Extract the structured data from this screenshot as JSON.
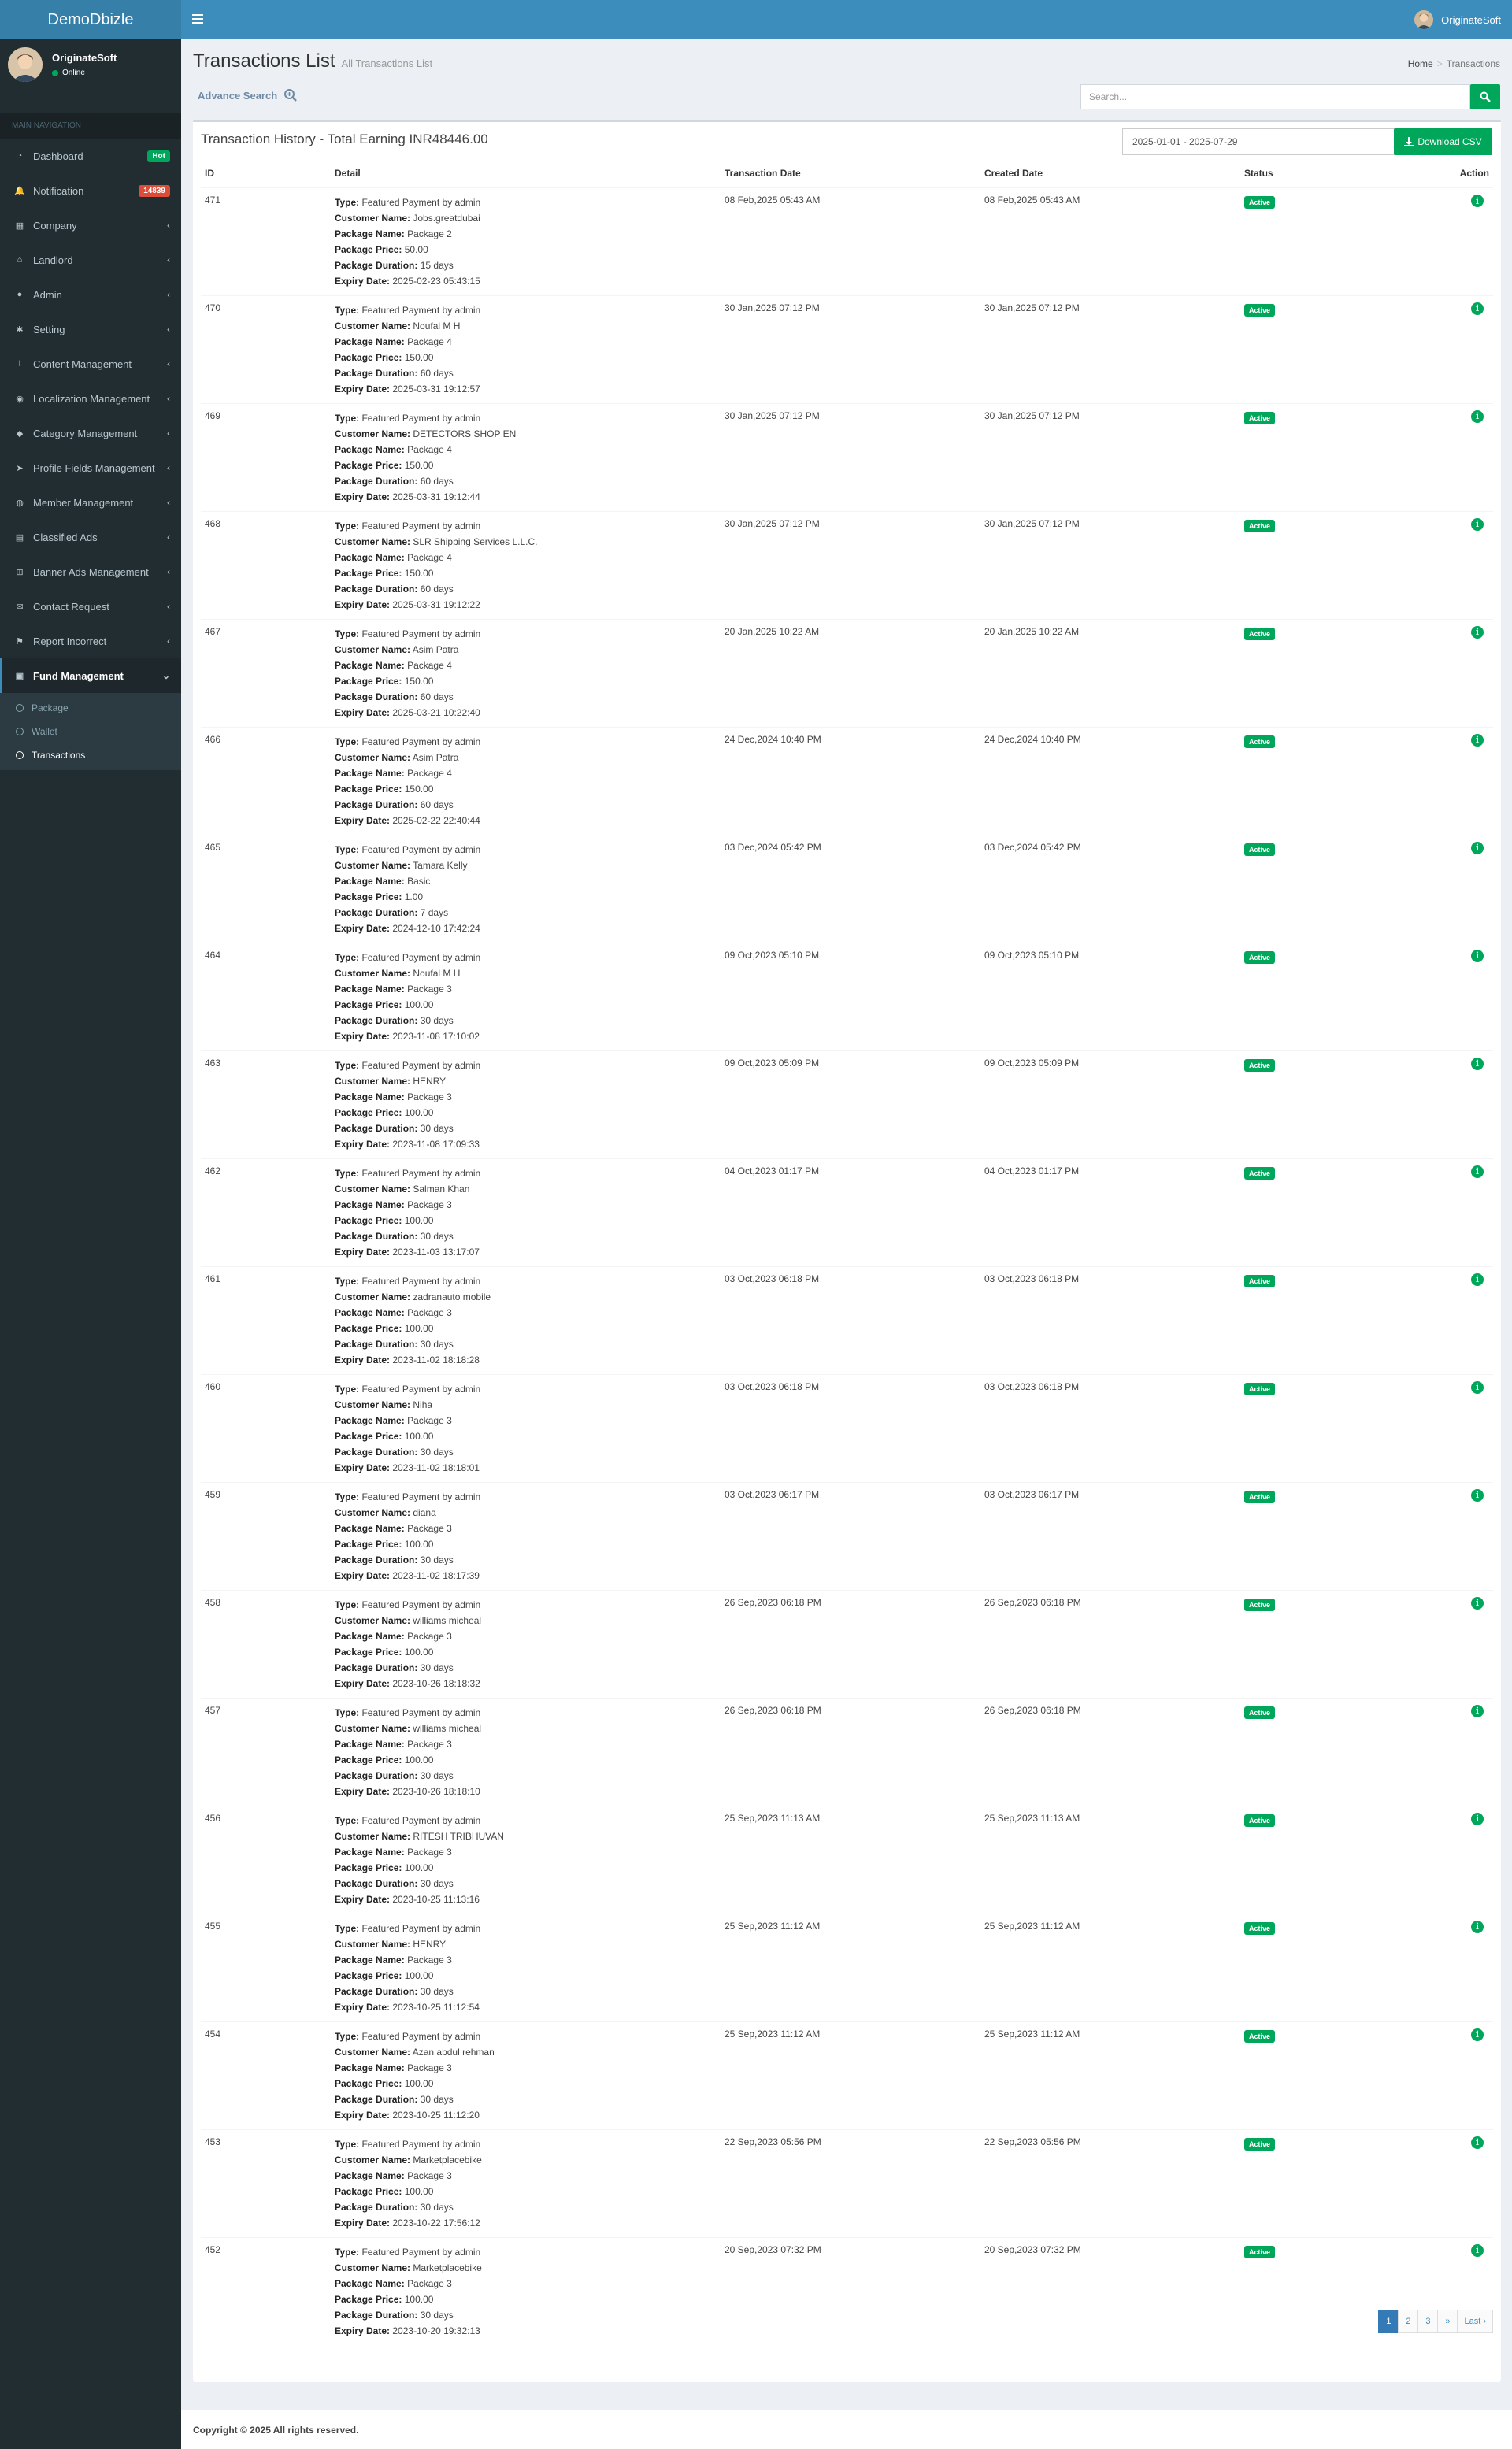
{
  "app": {
    "logo": "DemoDbizle",
    "top_user": "OriginateSoft"
  },
  "sidebar": {
    "user": {
      "name": "OriginateSoft",
      "status": "Online"
    },
    "header": "MAIN NAVIGATION",
    "items": [
      {
        "label": "Dashboard",
        "icon": "dashboard-icon",
        "badge": "Hot",
        "badge_color": "#00a65a"
      },
      {
        "label": "Notification",
        "icon": "bell-icon",
        "badge": "14839",
        "badge_color": "#dd4b39"
      },
      {
        "label": "Company",
        "icon": "building-icon"
      },
      {
        "label": "Landlord",
        "icon": "bank-icon"
      },
      {
        "label": "Admin",
        "icon": "user-icon"
      },
      {
        "label": "Setting",
        "icon": "gear-icon"
      },
      {
        "label": "Content Management",
        "icon": "text-cursor-icon"
      },
      {
        "label": "Localization Management",
        "icon": "map-marker-icon"
      },
      {
        "label": "Category Management",
        "icon": "tag-icon"
      },
      {
        "label": "Profile Fields Management",
        "icon": "pointer-icon"
      },
      {
        "label": "Member Management",
        "icon": "users-icon"
      },
      {
        "label": "Classified Ads",
        "icon": "newspaper-icon"
      },
      {
        "label": "Banner Ads Management",
        "icon": "cart-icon"
      },
      {
        "label": "Contact Request",
        "icon": "envelope-icon"
      },
      {
        "label": "Report Incorrect",
        "icon": "flag-icon"
      },
      {
        "label": "Fund Management",
        "icon": "money-icon",
        "active": true
      }
    ],
    "subitems": [
      {
        "label": "Package"
      },
      {
        "label": "Wallet"
      },
      {
        "label": "Transactions",
        "active": true
      }
    ]
  },
  "page": {
    "title": "Transactions List",
    "subtitle": "All Transactions List",
    "breadcrumb": [
      "Home",
      "Transactions"
    ],
    "advance_search": "Advance Search",
    "search_placeholder": "Search..."
  },
  "box": {
    "title": "Transaction History - Total Earning INR48446.00",
    "date_range": "2025-01-01 - 2025-07-29",
    "csv_label": "Download CSV"
  },
  "table": {
    "columns": [
      "ID",
      "Detail",
      "Transaction Date",
      "Created Date",
      "Status",
      "Action"
    ],
    "labels": {
      "type": "Type:",
      "customer": "Customer Name:",
      "package": "Package Name:",
      "price": "Package Price:",
      "duration": "Package Duration:",
      "expiry": "Expiry Date:"
    },
    "rows": [
      {
        "id": "471",
        "type": "Featured Payment by admin",
        "customer": "Jobs.greatdubai",
        "package": "Package 2",
        "price": "50.00",
        "duration": "15 days",
        "expiry": "2025-02-23 05:43:15",
        "tdate": "08 Feb,2025 05:43 AM",
        "cdate": "08 Feb,2025 05:43 AM",
        "status": "Active"
      },
      {
        "id": "470",
        "type": "Featured Payment by admin",
        "customer": "Noufal M H",
        "package": "Package 4",
        "price": "150.00",
        "duration": "60 days",
        "expiry": "2025-03-31 19:12:57",
        "tdate": "30 Jan,2025 07:12 PM",
        "cdate": "30 Jan,2025 07:12 PM",
        "status": "Active"
      },
      {
        "id": "469",
        "type": "Featured Payment by admin",
        "customer": "DETECTORS SHOP EN",
        "package": "Package 4",
        "price": "150.00",
        "duration": "60 days",
        "expiry": "2025-03-31 19:12:44",
        "tdate": "30 Jan,2025 07:12 PM",
        "cdate": "30 Jan,2025 07:12 PM",
        "status": "Active"
      },
      {
        "id": "468",
        "type": "Featured Payment by admin",
        "customer": "SLR Shipping Services L.L.C.",
        "package": "Package 4",
        "price": "150.00",
        "duration": "60 days",
        "expiry": "2025-03-31 19:12:22",
        "tdate": "30 Jan,2025 07:12 PM",
        "cdate": "30 Jan,2025 07:12 PM",
        "status": "Active"
      },
      {
        "id": "467",
        "type": "Featured Payment by admin",
        "customer": "Asim Patra",
        "package": "Package 4",
        "price": "150.00",
        "duration": "60 days",
        "expiry": "2025-03-21 10:22:40",
        "tdate": "20 Jan,2025 10:22 AM",
        "cdate": "20 Jan,2025 10:22 AM",
        "status": "Active"
      },
      {
        "id": "466",
        "type": "Featured Payment by admin",
        "customer": "Asim Patra",
        "package": "Package 4",
        "price": "150.00",
        "duration": "60 days",
        "expiry": "2025-02-22 22:40:44",
        "tdate": "24 Dec,2024 10:40 PM",
        "cdate": "24 Dec,2024 10:40 PM",
        "status": "Active"
      },
      {
        "id": "465",
        "type": "Featured Payment by admin",
        "customer": "Tamara Kelly",
        "package": "Basic",
        "price": "1.00",
        "duration": "7 days",
        "expiry": "2024-12-10 17:42:24",
        "tdate": "03 Dec,2024 05:42 PM",
        "cdate": "03 Dec,2024 05:42 PM",
        "status": "Active"
      },
      {
        "id": "464",
        "type": "Featured Payment by admin",
        "customer": "Noufal M H",
        "package": "Package 3",
        "price": "100.00",
        "duration": "30 days",
        "expiry": "2023-11-08 17:10:02",
        "tdate": "09 Oct,2023 05:10 PM",
        "cdate": "09 Oct,2023 05:10 PM",
        "status": "Active"
      },
      {
        "id": "463",
        "type": "Featured Payment by admin",
        "customer": "HENRY",
        "package": "Package 3",
        "price": "100.00",
        "duration": "30 days",
        "expiry": "2023-11-08 17:09:33",
        "tdate": "09 Oct,2023 05:09 PM",
        "cdate": "09 Oct,2023 05:09 PM",
        "status": "Active"
      },
      {
        "id": "462",
        "type": "Featured Payment by admin",
        "customer": "Salman Khan",
        "package": "Package 3",
        "price": "100.00",
        "duration": "30 days",
        "expiry": "2023-11-03 13:17:07",
        "tdate": "04 Oct,2023 01:17 PM",
        "cdate": "04 Oct,2023 01:17 PM",
        "status": "Active"
      },
      {
        "id": "461",
        "type": "Featured Payment by admin",
        "customer": "zadranauto mobile",
        "package": "Package 3",
        "price": "100.00",
        "duration": "30 days",
        "expiry": "2023-11-02 18:18:28",
        "tdate": "03 Oct,2023 06:18 PM",
        "cdate": "03 Oct,2023 06:18 PM",
        "status": "Active"
      },
      {
        "id": "460",
        "type": "Featured Payment by admin",
        "customer": "Niha",
        "package": "Package 3",
        "price": "100.00",
        "duration": "30 days",
        "expiry": "2023-11-02 18:18:01",
        "tdate": "03 Oct,2023 06:18 PM",
        "cdate": "03 Oct,2023 06:18 PM",
        "status": "Active"
      },
      {
        "id": "459",
        "type": "Featured Payment by admin",
        "customer": "diana",
        "package": "Package 3",
        "price": "100.00",
        "duration": "30 days",
        "expiry": "2023-11-02 18:17:39",
        "tdate": "03 Oct,2023 06:17 PM",
        "cdate": "03 Oct,2023 06:17 PM",
        "status": "Active"
      },
      {
        "id": "458",
        "type": "Featured Payment by admin",
        "customer": "williams micheal",
        "package": "Package 3",
        "price": "100.00",
        "duration": "30 days",
        "expiry": "2023-10-26 18:18:32",
        "tdate": "26 Sep,2023 06:18 PM",
        "cdate": "26 Sep,2023 06:18 PM",
        "status": "Active"
      },
      {
        "id": "457",
        "type": "Featured Payment by admin",
        "customer": "williams micheal",
        "package": "Package 3",
        "price": "100.00",
        "duration": "30 days",
        "expiry": "2023-10-26 18:18:10",
        "tdate": "26 Sep,2023 06:18 PM",
        "cdate": "26 Sep,2023 06:18 PM",
        "status": "Active"
      },
      {
        "id": "456",
        "type": "Featured Payment by admin",
        "customer": "RITESH TRIBHUVAN",
        "package": "Package 3",
        "price": "100.00",
        "duration": "30 days",
        "expiry": "2023-10-25 11:13:16",
        "tdate": "25 Sep,2023 11:13 AM",
        "cdate": "25 Sep,2023 11:13 AM",
        "status": "Active"
      },
      {
        "id": "455",
        "type": "Featured Payment by admin",
        "customer": "HENRY",
        "package": "Package 3",
        "price": "100.00",
        "duration": "30 days",
        "expiry": "2023-10-25 11:12:54",
        "tdate": "25 Sep,2023 11:12 AM",
        "cdate": "25 Sep,2023 11:12 AM",
        "status": "Active"
      },
      {
        "id": "454",
        "type": "Featured Payment by admin",
        "customer": "Azan abdul rehman",
        "package": "Package 3",
        "price": "100.00",
        "duration": "30 days",
        "expiry": "2023-10-25 11:12:20",
        "tdate": "25 Sep,2023 11:12 AM",
        "cdate": "25 Sep,2023 11:12 AM",
        "status": "Active"
      },
      {
        "id": "453",
        "type": "Featured Payment by admin",
        "customer": "Marketplacebike",
        "package": "Package 3",
        "price": "100.00",
        "duration": "30 days",
        "expiry": "2023-10-22 17:56:12",
        "tdate": "22 Sep,2023 05:56 PM",
        "cdate": "22 Sep,2023 05:56 PM",
        "status": "Active"
      },
      {
        "id": "452",
        "type": "Featured Payment by admin",
        "customer": "Marketplacebike",
        "package": "Package 3",
        "price": "100.00",
        "duration": "30 days",
        "expiry": "2023-10-20 19:32:13",
        "tdate": "20 Sep,2023 07:32 PM",
        "cdate": "20 Sep,2023 07:32 PM",
        "status": "Active"
      }
    ]
  },
  "pagination": {
    "pages": [
      "1",
      "2",
      "3",
      "»",
      "Last ›"
    ],
    "current": "1"
  },
  "footer": {
    "text": "Copyright © 2025 All rights reserved."
  },
  "colors": {
    "primary": "#3c8dbc",
    "sidebar": "#222d32",
    "success": "#00a65a",
    "danger": "#dd4b39"
  }
}
